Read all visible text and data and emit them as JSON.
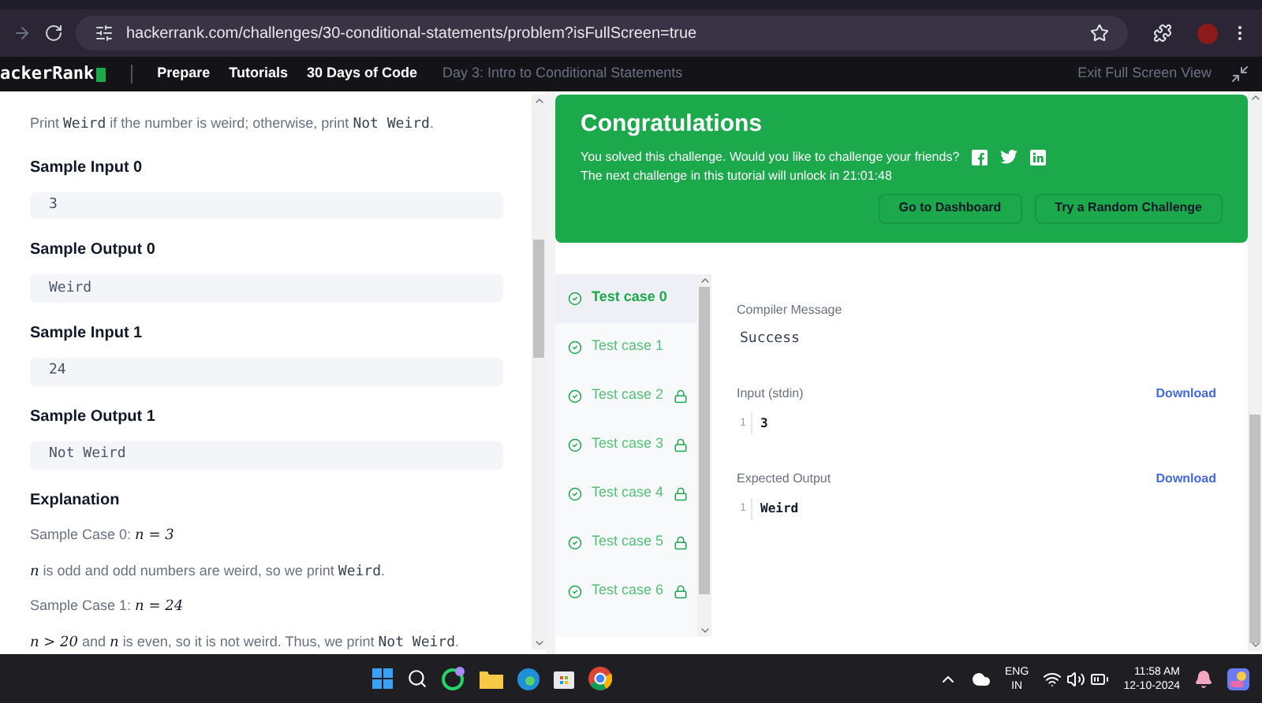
{
  "browser": {
    "url": "hackerrank.com/challenges/30-conditional-statements/problem?isFullScreen=true"
  },
  "nav": {
    "logo": "ackerRank",
    "links": [
      "Prepare",
      "Tutorials",
      "30 Days of Code"
    ],
    "current": "Day 3: Intro to Conditional Statements",
    "exit": "Exit Full Screen View"
  },
  "problem": {
    "blocks": [
      {
        "kind": "para",
        "parts": [
          {
            "kind": "text",
            "text": "Print "
          },
          {
            "kind": "code",
            "text": "Weird"
          },
          {
            "kind": "text",
            "text": " if the number is weird; otherwise, print "
          },
          {
            "kind": "code",
            "text": "Not Weird"
          },
          {
            "kind": "text",
            "text": "."
          }
        ]
      },
      {
        "kind": "heading",
        "text": "Sample Input 0"
      },
      {
        "kind": "sample",
        "text": "3"
      },
      {
        "kind": "heading",
        "text": "Sample Output 0"
      },
      {
        "kind": "sample",
        "text": "Weird"
      },
      {
        "kind": "heading",
        "text": "Sample Input 1"
      },
      {
        "kind": "sample",
        "text": "24"
      },
      {
        "kind": "heading",
        "text": "Sample Output 1"
      },
      {
        "kind": "sample",
        "text": "Not Weird"
      },
      {
        "kind": "heading",
        "text": "Explanation"
      },
      {
        "kind": "para",
        "parts": [
          {
            "kind": "text",
            "text": "Sample Case 0: "
          },
          {
            "kind": "math",
            "text": "n = 3"
          }
        ]
      },
      {
        "kind": "para",
        "parts": [
          {
            "kind": "math",
            "text": "n"
          },
          {
            "kind": "text",
            "text": " is odd and odd numbers are weird, so we print "
          },
          {
            "kind": "code",
            "text": "Weird"
          },
          {
            "kind": "text",
            "text": "."
          }
        ]
      },
      {
        "kind": "para",
        "parts": [
          {
            "kind": "text",
            "text": "Sample Case 1: "
          },
          {
            "kind": "math",
            "text": "n = 24"
          }
        ]
      },
      {
        "kind": "para",
        "parts": [
          {
            "kind": "math",
            "text": "n > 20"
          },
          {
            "kind": "text",
            "text": " and "
          },
          {
            "kind": "math",
            "text": "n"
          },
          {
            "kind": "text",
            "text": " is even, so it is not weird. Thus, we print "
          },
          {
            "kind": "code",
            "text": "Not Weird"
          },
          {
            "kind": "text",
            "text": "."
          }
        ]
      }
    ]
  },
  "banner": {
    "title": "Congratulations",
    "message": "You solved this challenge. Would you like to challenge your friends?",
    "unlock": "The next challenge in this tutorial will unlock in 21:01:48",
    "buttons": [
      "Go to Dashboard",
      "Try a Random Challenge"
    ]
  },
  "test_cases": [
    {
      "label": "Test case 0",
      "selected": true,
      "locked": false
    },
    {
      "label": "Test case 1",
      "selected": false,
      "locked": false
    },
    {
      "label": "Test case 2",
      "selected": false,
      "locked": true
    },
    {
      "label": "Test case 3",
      "selected": false,
      "locked": true
    },
    {
      "label": "Test case 4",
      "selected": false,
      "locked": true
    },
    {
      "label": "Test case 5",
      "selected": false,
      "locked": true
    },
    {
      "label": "Test case 6",
      "selected": false,
      "locked": true
    }
  ],
  "result": {
    "compiler_label": "Compiler Message",
    "compiler_message": "Success",
    "sections": [
      {
        "label": "Input (stdin)",
        "download": "Download",
        "line": "1",
        "value": "3"
      },
      {
        "label": "Expected Output",
        "download": "Download",
        "line": "1",
        "value": "Weird"
      }
    ]
  },
  "taskbar": {
    "lang": "ENG",
    "region": "IN",
    "time": "11:58 AM",
    "date": "12-10-2024"
  }
}
